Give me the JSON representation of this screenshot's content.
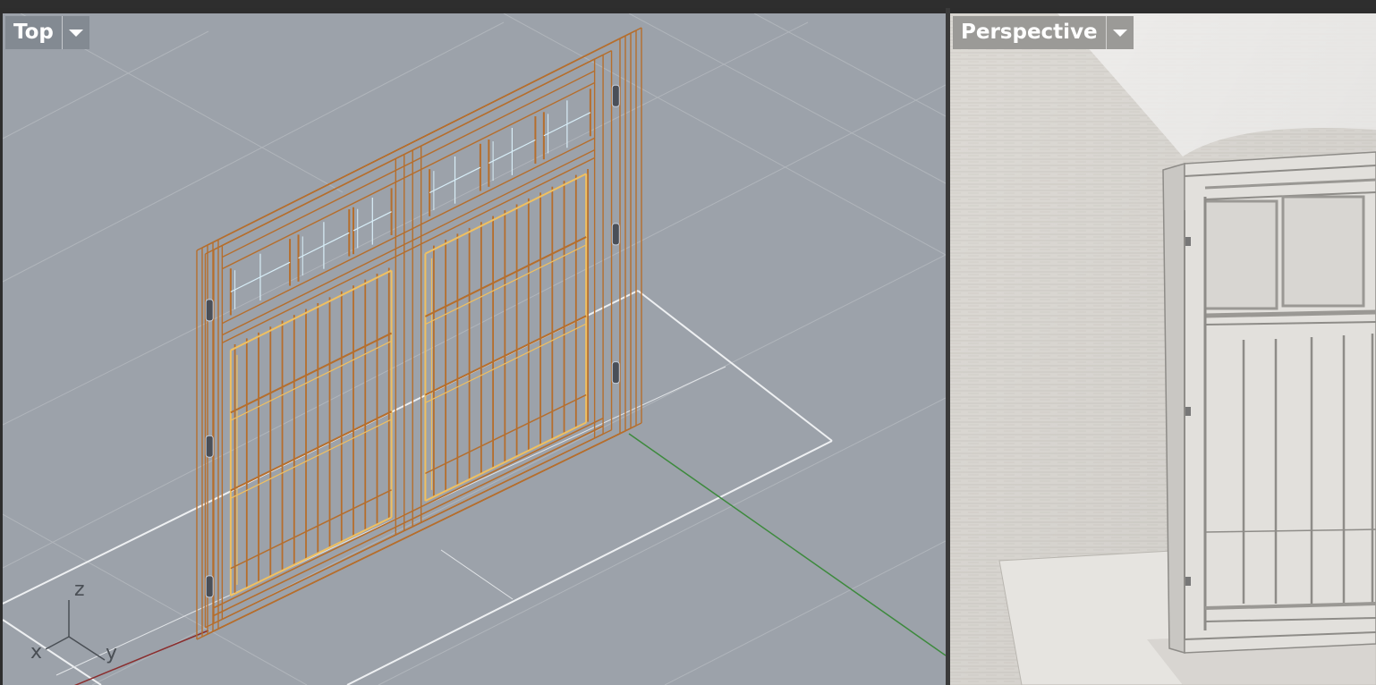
{
  "viewports": {
    "top": {
      "label": "Top"
    },
    "perspective": {
      "label": "Perspective"
    }
  },
  "axis_widget": {
    "z": "z",
    "x": "x",
    "y": "y"
  },
  "icons": {
    "dropdown": "chevron-down-icon"
  },
  "colors": {
    "wireframe": "#b66e2c",
    "selected_highlight": "#f0c060",
    "glass": "#d8eef8",
    "grid": "#b4b9bf",
    "grid_major": "#e8eaec",
    "x_axis": "#8a2e2e",
    "y_axis": "#3d8a3d",
    "viewport_top_bg": "#9ca2aa",
    "viewport_persp_bg": "#dedbd6"
  }
}
